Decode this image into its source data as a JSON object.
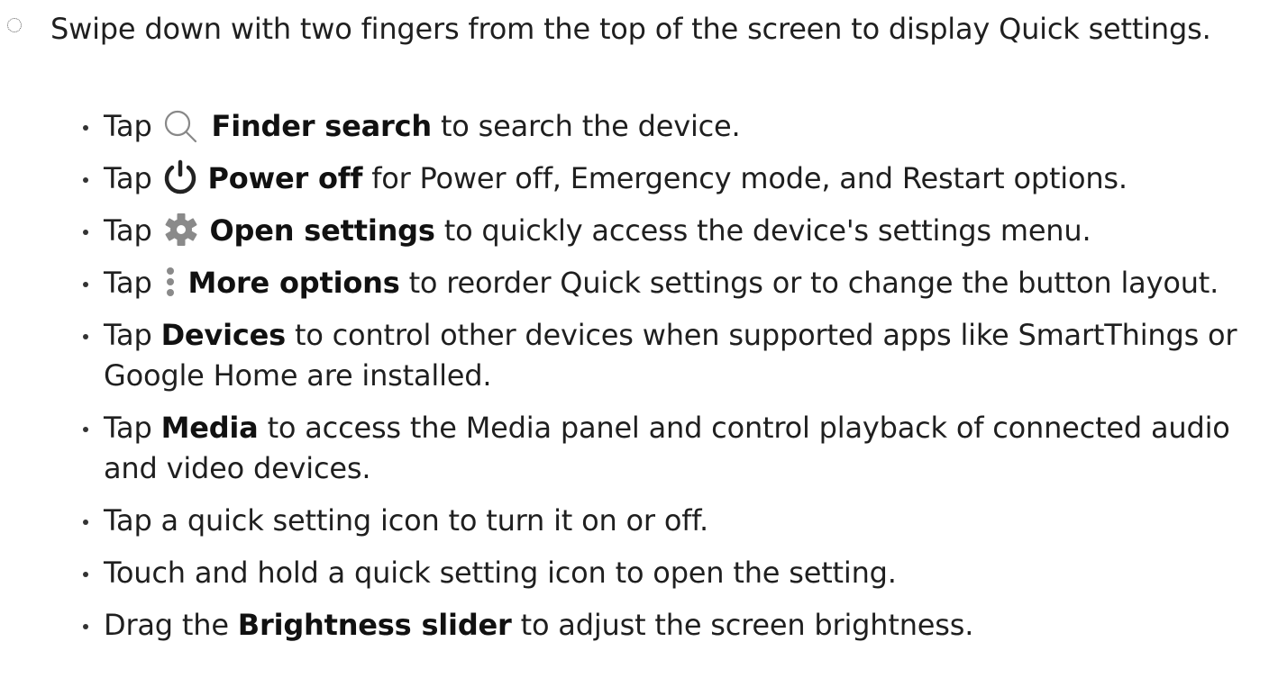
{
  "step": {
    "text": "Swipe down with two fingers from the top of the screen to display Quick settings."
  },
  "bullets": [
    {
      "pre": "Tap",
      "icon": "search-icon",
      "term": "Finder search",
      "post": "to search the device."
    },
    {
      "pre": "Tap",
      "icon": "power-icon",
      "term": "Power off",
      "post": "for Power off, Emergency mode, and Restart options."
    },
    {
      "pre": "Tap",
      "icon": "gear-icon",
      "term": "Open settings",
      "post": "to quickly access the device's settings menu."
    },
    {
      "pre": "Tap",
      "icon": "more-options-icon",
      "term": "More options",
      "post": "to reorder Quick settings or to change the button layout."
    },
    {
      "pre": "Tap",
      "term": "Devices",
      "post": "to control other devices when supported apps like SmartThings or Google Home are installed."
    },
    {
      "pre": "Tap",
      "term": "Media",
      "post": "to access the Media panel and control playback of connected audio and video devices."
    },
    {
      "text": "Tap a quick setting icon to turn it on or off."
    },
    {
      "text": "Touch and hold a quick setting icon to open the setting."
    },
    {
      "pre": "Drag the",
      "term": "Brightness slider",
      "post": "to adjust the screen brightness."
    }
  ]
}
